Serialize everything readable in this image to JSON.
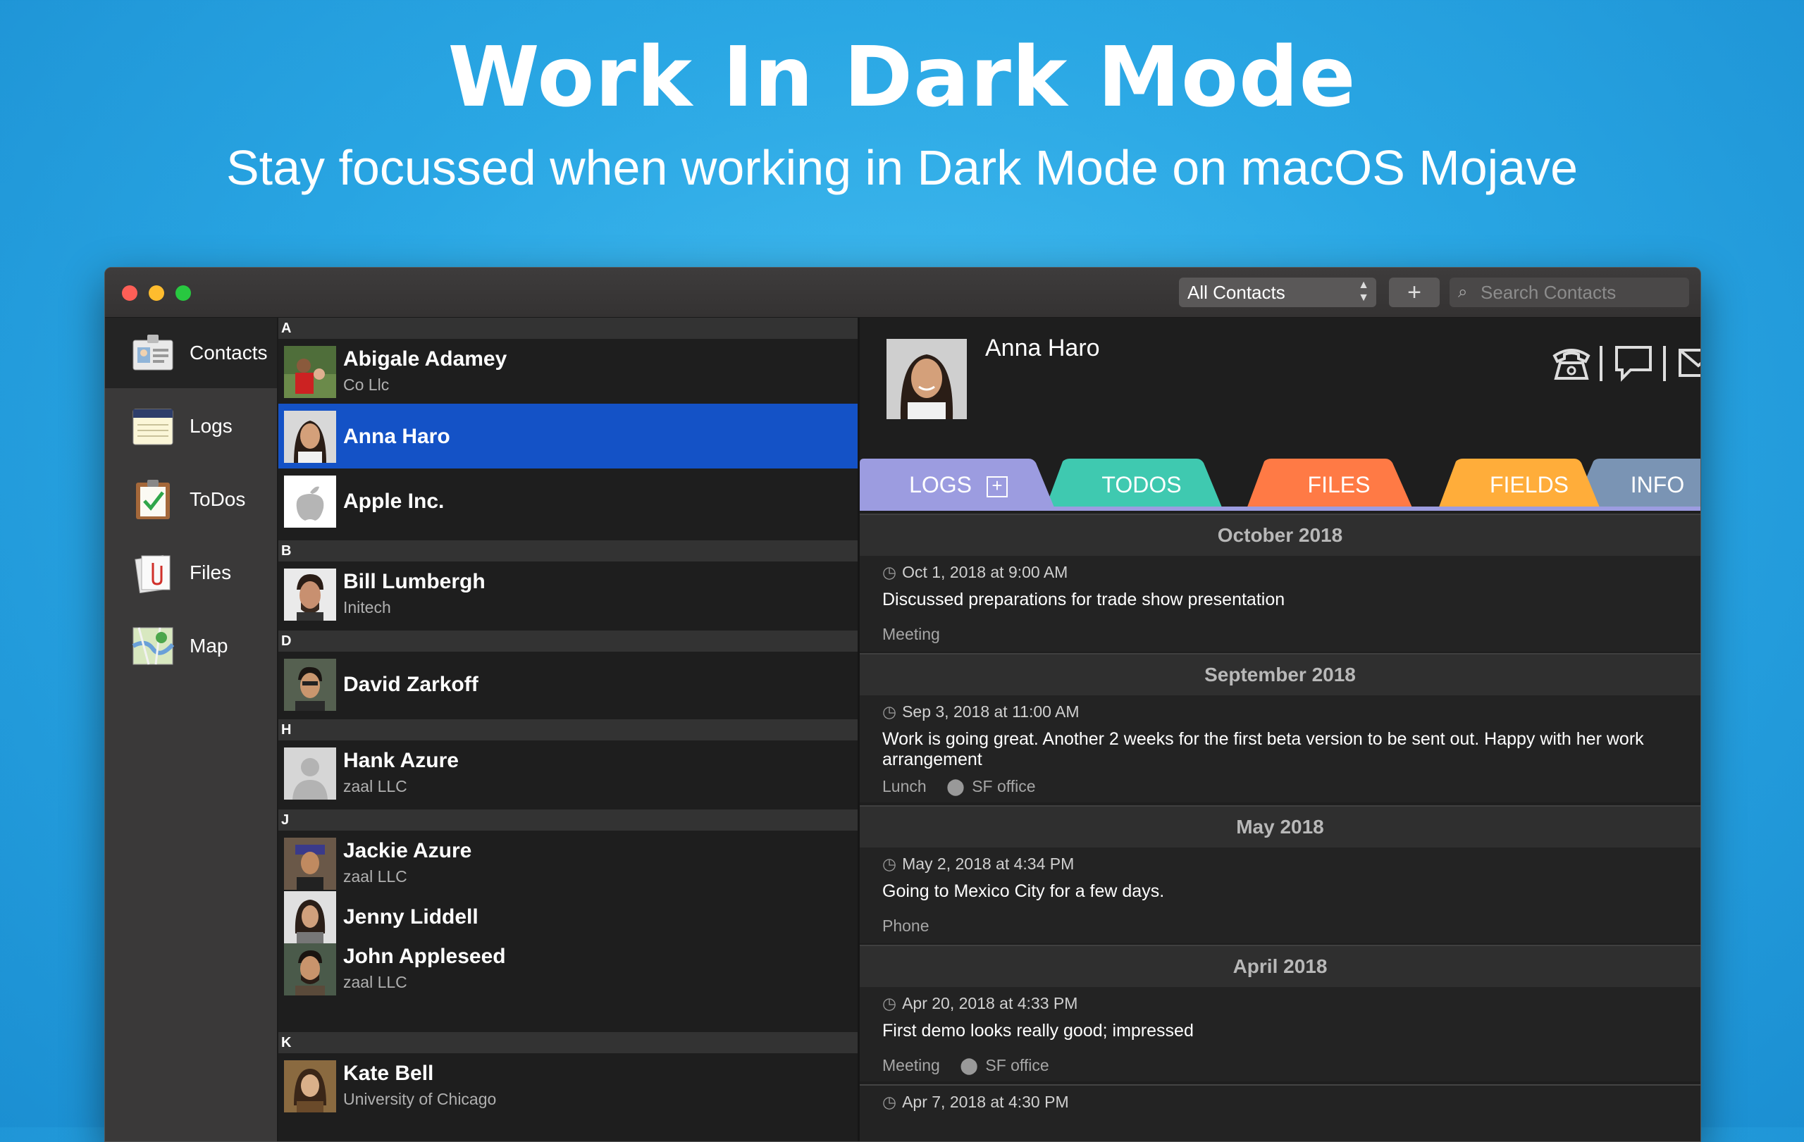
{
  "hero": {
    "title": "Work In Dark Mode",
    "subtitle": "Stay focussed when working in Dark Mode on macOS Mojave"
  },
  "toolbar": {
    "group_select": "All Contacts",
    "add_label": "+",
    "search_placeholder": "Search Contacts"
  },
  "sidebar": {
    "items": [
      {
        "label": "Contacts",
        "icon": "contacts-card-icon"
      },
      {
        "label": "Logs",
        "icon": "logs-notebook-icon"
      },
      {
        "label": "ToDos",
        "icon": "todos-clipboard-icon"
      },
      {
        "label": "Files",
        "icon": "files-paperclip-icon"
      },
      {
        "label": "Map",
        "icon": "map-icon"
      }
    ]
  },
  "contacts": {
    "sections": [
      "A",
      "B",
      "D",
      "H",
      "J",
      "K"
    ],
    "items": [
      {
        "name": "Abigale Adamey",
        "company": "Co Llc"
      },
      {
        "name": "Anna Haro",
        "company": ""
      },
      {
        "name": "Apple Inc.",
        "company": ""
      },
      {
        "name": "Bill Lumbergh",
        "company": "Initech"
      },
      {
        "name": "David Zarkoff",
        "company": ""
      },
      {
        "name": "Hank Azure",
        "company": "zaal LLC"
      },
      {
        "name": "Jackie Azure",
        "company": "zaal LLC"
      },
      {
        "name": "Jenny Liddell",
        "company": ""
      },
      {
        "name": "John Appleseed",
        "company": "zaal LLC"
      },
      {
        "name": "Kate Bell",
        "company": "University of Chicago"
      }
    ]
  },
  "detail": {
    "name": "Anna Haro",
    "tabs": [
      "LOGS",
      "TODOS",
      "FILES",
      "FIELDS",
      "INFO"
    ],
    "tab_colors": [
      "#9c9ce0",
      "#3fc9b0",
      "#ff7a45",
      "#ffad3a",
      "#7a94b4"
    ],
    "months": [
      "October 2018",
      "September 2018",
      "May 2018",
      "April 2018"
    ],
    "logs": [
      {
        "when": "Oct 1, 2018 at 9:00 AM",
        "text": "Discussed preparations for trade show presentation",
        "type": "Meeting",
        "location": ""
      },
      {
        "when": "Sep 3, 2018 at 11:00 AM",
        "text": "Work is going great. Another 2 weeks for the first beta version to be sent out. Happy with her work arrangement",
        "type": "Lunch",
        "location": "SF office"
      },
      {
        "when": "May 2, 2018 at 4:34 PM",
        "text": "Going to Mexico City for a few days.",
        "type": "Phone",
        "location": ""
      },
      {
        "when": "Apr 20, 2018 at 4:33 PM",
        "text": "First demo looks really good; impressed",
        "type": "Meeting",
        "location": "SF office"
      },
      {
        "when": "Apr 7, 2018 at 4:30 PM",
        "text": "",
        "type": "",
        "location": ""
      }
    ]
  }
}
